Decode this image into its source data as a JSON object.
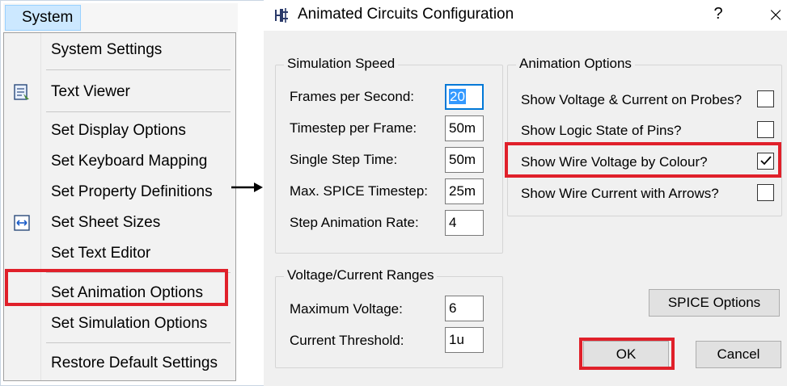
{
  "menu": {
    "title": "System",
    "items": [
      {
        "label": "System Settings",
        "icon": null
      },
      {
        "label": "Text Viewer",
        "icon": "text-viewer-icon"
      },
      {
        "label": "Set Display Options",
        "icon": null
      },
      {
        "label": "Set Keyboard Mapping",
        "icon": null
      },
      {
        "label": "Set Property Definitions",
        "icon": null
      },
      {
        "label": "Set Sheet Sizes",
        "icon": "sheet-size-icon"
      },
      {
        "label": "Set Text Editor",
        "icon": null
      },
      {
        "label": "Set Animation Options",
        "icon": null
      },
      {
        "label": "Set Simulation Options",
        "icon": null
      },
      {
        "label": "Restore Default Settings",
        "icon": null
      }
    ],
    "highlighted_item": "Set Animation Options"
  },
  "dialog": {
    "title": "Animated Circuits Configuration",
    "help_label": "?",
    "close_label": "×",
    "simulation_speed": {
      "legend": "Simulation Speed",
      "fields": [
        {
          "label": "Frames per Second:",
          "value": "20"
        },
        {
          "label": "Timestep per Frame:",
          "value": "50m"
        },
        {
          "label": "Single Step Time:",
          "value": "50m"
        },
        {
          "label": "Max. SPICE Timestep:",
          "value": "25m"
        },
        {
          "label": "Step Animation Rate:",
          "value": "4"
        }
      ]
    },
    "ranges": {
      "legend": "Voltage/Current Ranges",
      "fields": [
        {
          "label": "Maximum Voltage:",
          "value": "6"
        },
        {
          "label": "Current Threshold:",
          "value": "1u"
        }
      ]
    },
    "animation_options": {
      "legend": "Animation Options",
      "options": [
        {
          "label": "Show Voltage & Current on Probes?",
          "checked": false
        },
        {
          "label": "Show Logic State of Pins?",
          "checked": false
        },
        {
          "label": "Show Wire Voltage by Colour?",
          "checked": true
        },
        {
          "label": "Show Wire Current with Arrows?",
          "checked": false
        }
      ]
    },
    "buttons": {
      "spice": "SPICE Options",
      "ok": "OK",
      "cancel": "Cancel"
    }
  },
  "colors": {
    "highlight": "#e0202a",
    "selection": "#3399ff",
    "menu_title_bg": "#cce8ff"
  }
}
